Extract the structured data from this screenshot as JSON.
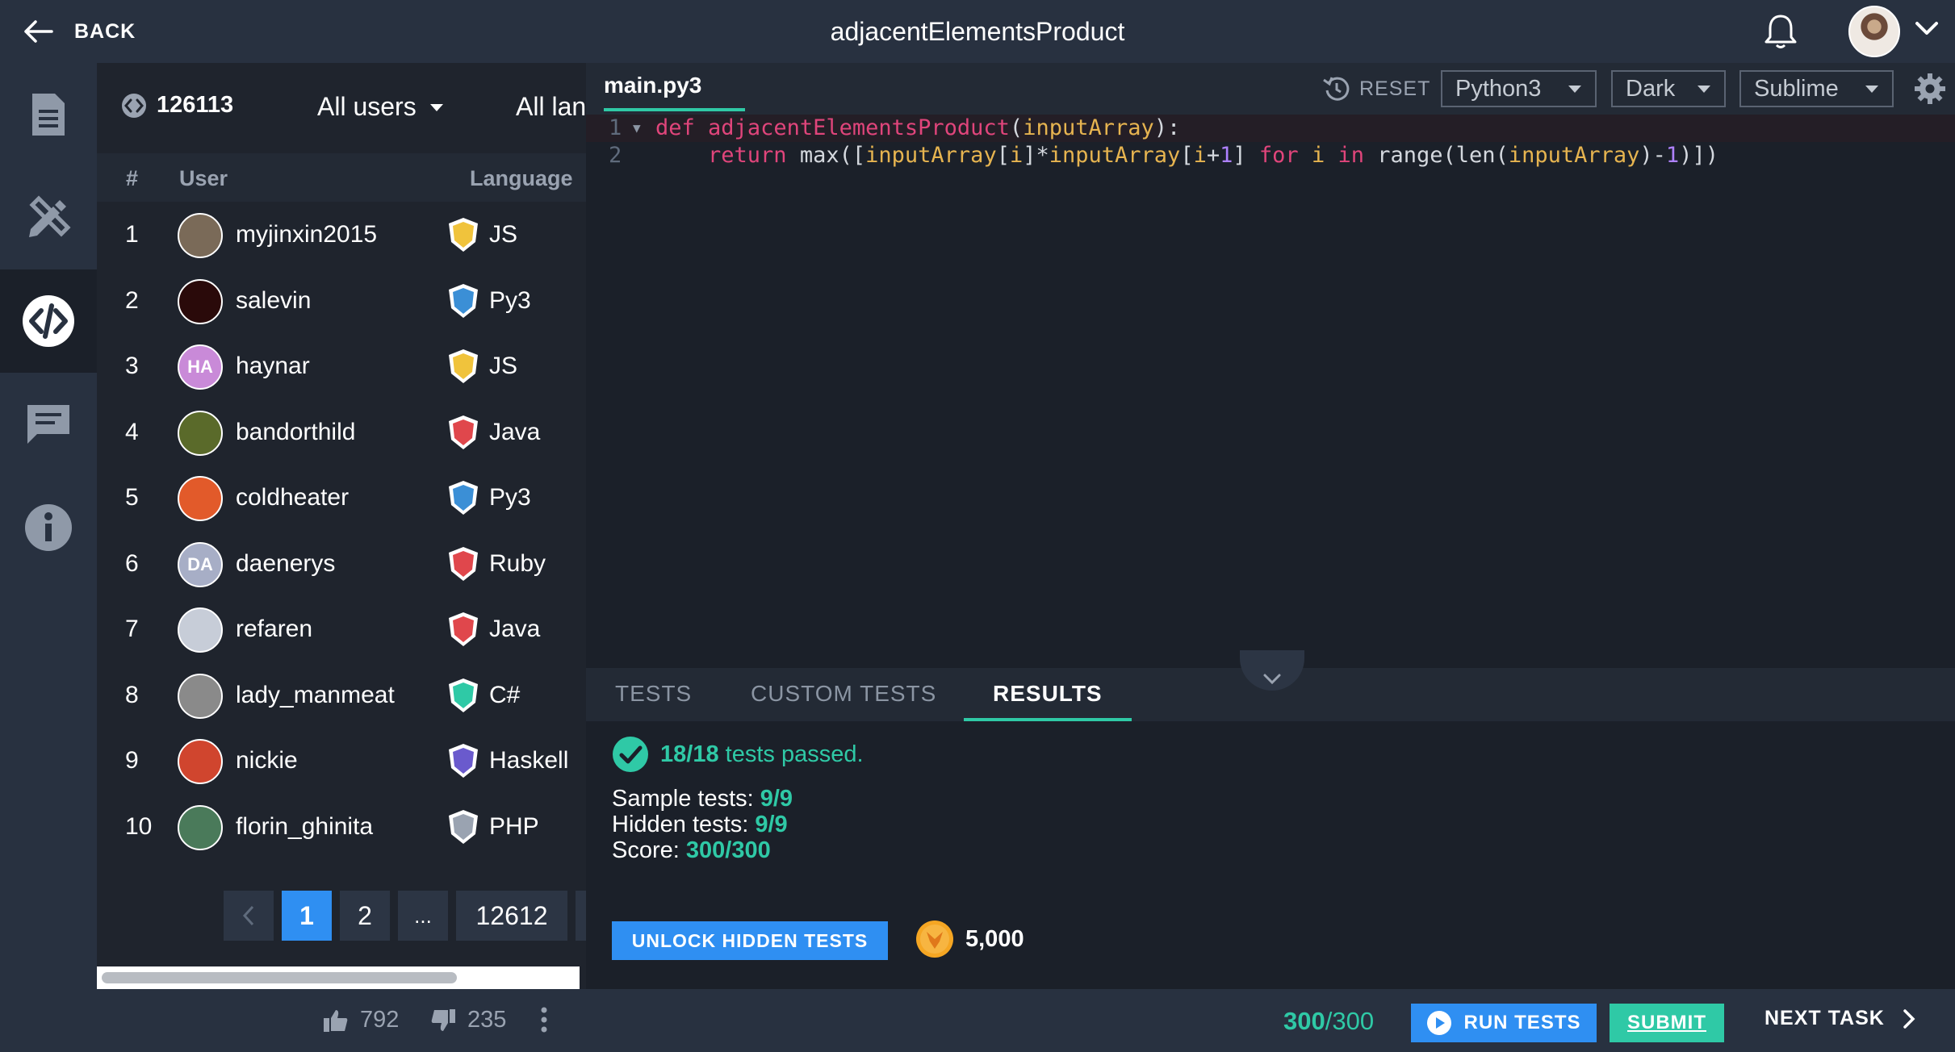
{
  "header": {
    "back_label": "BACK",
    "title": "adjacentElementsProduct",
    "bell_icon": "bell-icon",
    "avatar_menu_icon": "chevron-down-icon"
  },
  "rail": {
    "items": [
      {
        "name": "description",
        "icon": "document-icon"
      },
      {
        "name": "solutions",
        "icon": "pencil-ruler-icon"
      },
      {
        "name": "code",
        "icon": "code-icon",
        "active": true
      },
      {
        "name": "comments",
        "icon": "comment-icon"
      },
      {
        "name": "info",
        "icon": "info-icon"
      }
    ]
  },
  "leaderboard": {
    "solvers_count": "126113",
    "filter_users": "All users",
    "filter_languages": "All languages",
    "columns": {
      "rank": "#",
      "user": "User",
      "language": "Language"
    },
    "rows": [
      {
        "rank": "1",
        "user": "myjinxin2015",
        "language": "JS",
        "avatar": "",
        "avatar_color": "#7a6a58",
        "lang_color": "#f0c33c"
      },
      {
        "rank": "2",
        "user": "salevin",
        "language": "Py3",
        "avatar": "",
        "avatar_color": "#2a0a0a",
        "lang_color": "#3b8fd6"
      },
      {
        "rank": "3",
        "user": "haynar",
        "language": "JS",
        "avatar": "HA",
        "avatar_color": "#c98ad8",
        "lang_color": "#f0c33c"
      },
      {
        "rank": "4",
        "user": "bandorthild",
        "language": "Java",
        "avatar": "",
        "avatar_color": "#5a6a2a",
        "lang_color": "#e0474c"
      },
      {
        "rank": "5",
        "user": "coldheater",
        "language": "Py3",
        "avatar": "",
        "avatar_color": "#e25a2a",
        "lang_color": "#3b8fd6"
      },
      {
        "rank": "6",
        "user": "daenerys",
        "language": "Ruby",
        "avatar": "DA",
        "avatar_color": "#a7aec6",
        "lang_color": "#e0474c"
      },
      {
        "rank": "7",
        "user": "refaren",
        "language": "Java",
        "avatar": "",
        "avatar_color": "#c7cdd8",
        "lang_color": "#e0474c"
      },
      {
        "rank": "8",
        "user": "lady_manmeat",
        "language": "C#",
        "avatar": "",
        "avatar_color": "#8a8a8a",
        "lang_color": "#2fc9a6"
      },
      {
        "rank": "9",
        "user": "nickie",
        "language": "Haskell",
        "avatar": "",
        "avatar_color": "#d0452e",
        "lang_color": "#6a5acd"
      },
      {
        "rank": "10",
        "user": "florin_ghinita",
        "language": "PHP",
        "avatar": "",
        "avatar_color": "#4a7a5a",
        "lang_color": "#9aa3b1"
      }
    ],
    "pagination": {
      "prev": "<",
      "pages": [
        "1",
        "2",
        "...",
        "12612"
      ],
      "current": "1"
    },
    "likes": "792",
    "dislikes": "235"
  },
  "editor": {
    "file_tab": "main.py3",
    "reset_label": "RESET",
    "language": "Python3",
    "theme": "Dark",
    "keymap": "Sublime",
    "lines": [
      {
        "n": "1",
        "text": "def adjacentElementsProduct(inputArray):"
      },
      {
        "n": "2",
        "text": "    return max([inputArray[i]*inputArray[i+1] for i in range(len(inputArray)-1)])"
      }
    ]
  },
  "results": {
    "tabs": [
      "TESTS",
      "CUSTOM TESTS",
      "RESULTS"
    ],
    "active_tab": "RESULTS",
    "passed_count": "18/18",
    "passed_text": "tests passed.",
    "sample_label": "Sample tests:",
    "sample_value": "9/9",
    "hidden_label": "Hidden tests:",
    "hidden_value": "9/9",
    "score_label": "Score:",
    "score_value": "300/300",
    "unlock_label": "UNLOCK HIDDEN TESTS",
    "coins": "5,000"
  },
  "bottom": {
    "score_got": "300",
    "score_total": "/300",
    "run_label": "RUN TESTS",
    "submit_label": "SUBMIT",
    "next_label": "NEXT TASK"
  },
  "colors": {
    "accent_green": "#2fc9a6",
    "accent_blue": "#2f8ff2",
    "header_bg": "#283140",
    "editor_bg": "#1b2029"
  }
}
